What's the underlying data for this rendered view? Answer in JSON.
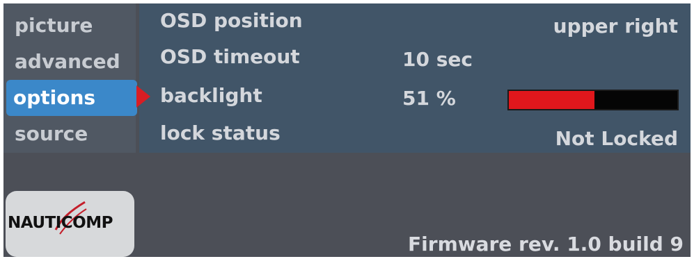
{
  "sidebar": {
    "items": [
      {
        "label": "picture"
      },
      {
        "label": "advanced"
      },
      {
        "label": "options"
      },
      {
        "label": "source"
      }
    ]
  },
  "rows": {
    "osd_position": {
      "label": "OSD position",
      "value": "upper right"
    },
    "osd_timeout": {
      "label": "OSD timeout",
      "value": "10 sec"
    },
    "backlight": {
      "label": "backlight",
      "value": "51 %",
      "level": 0.51
    },
    "lock_status": {
      "label": "lock status",
      "value": "Not Locked"
    }
  },
  "logo": {
    "text": "NAUTICOMP"
  },
  "footer": {
    "firmware": "Firmware rev. 1.0 build 9"
  },
  "colors": {
    "accent": "#3b88c9",
    "bar_fill": "#e0171c",
    "arrow": "#d81d24"
  }
}
